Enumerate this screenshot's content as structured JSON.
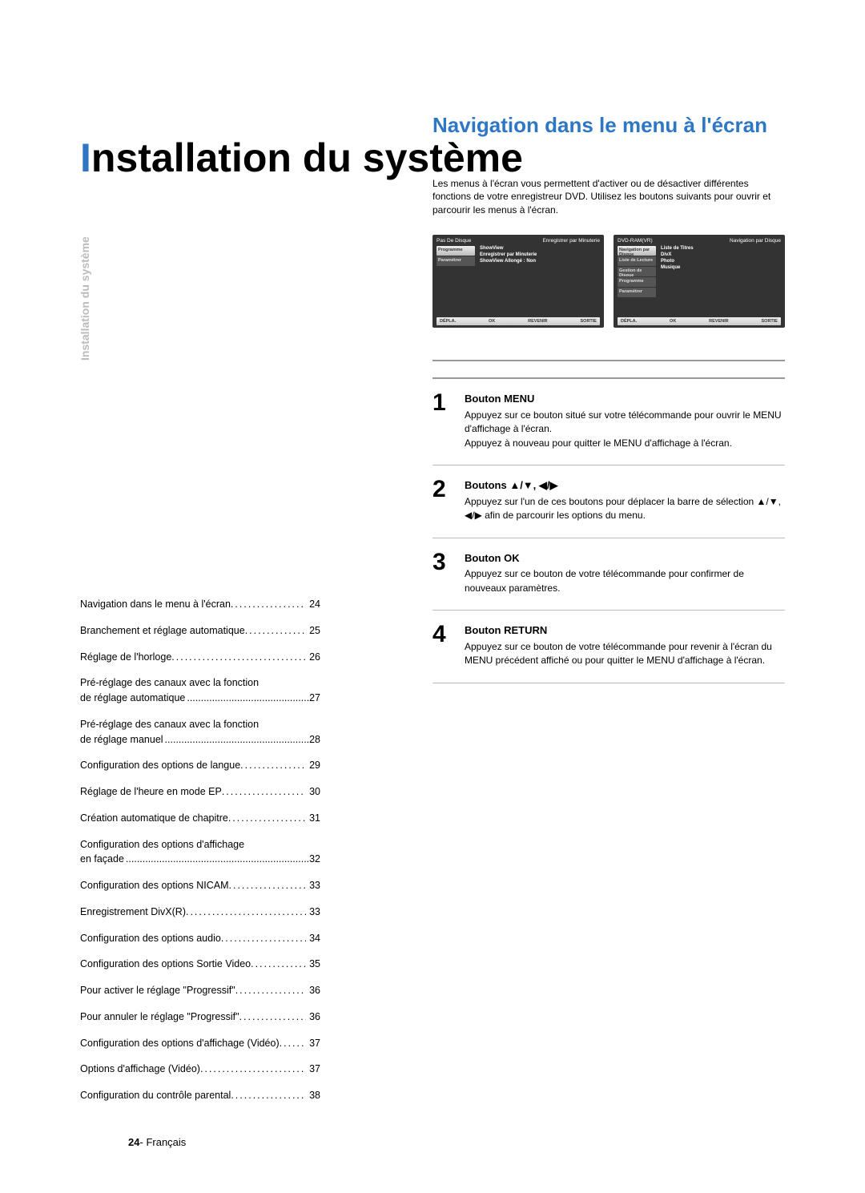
{
  "sidebar_tab": "Installation du système",
  "main_title_prefix": "I",
  "main_title_rest": "nstallation du système",
  "toc": [
    {
      "text": "Navigation dans le menu à l'écran",
      "page": "24"
    },
    {
      "text": "Branchement et réglage automatique",
      "page": "25"
    },
    {
      "text": "Réglage de l'horloge",
      "page": "26"
    },
    {
      "text": "Pré-réglage des canaux avec la fonction de réglage automatique",
      "page": "27",
      "multiline": true
    },
    {
      "text": "Pré-réglage des canaux avec la fonction de réglage manuel",
      "page": "28",
      "multiline": true
    },
    {
      "text": "Configuration des options de langue",
      "page": "29"
    },
    {
      "text": "Réglage de l'heure en mode EP",
      "page": "30"
    },
    {
      "text": "Création automatique de chapitre",
      "page": "31"
    },
    {
      "text": "Configuration des options d'affichage en façade",
      "page": "32",
      "multiline": true
    },
    {
      "text": "Configuration des options NICAM",
      "page": "33"
    },
    {
      "text": "Enregistrement DivX(R)",
      "page": "33"
    },
    {
      "text": "Configuration des options audio",
      "page": "34"
    },
    {
      "text": "Configuration des options Sortie Video",
      "page": "35"
    },
    {
      "text": "Pour activer le réglage \"Progressif\"",
      "page": "36"
    },
    {
      "text": "Pour annuler le réglage \"Progressif\"",
      "page": "36"
    },
    {
      "text": "Configuration des options d'affichage (Vidéo)",
      "page": "37"
    },
    {
      "text": "Options d'affichage (Vidéo)",
      "page": "37"
    },
    {
      "text": "Configuration du contrôle parental",
      "page": "38"
    }
  ],
  "section_heading": "Navigation dans le menu à l'écran",
  "intro_text": "Les menus à l'écran vous permettent d'activer ou de désactiver différentes fonctions de votre enregistreur DVD. Utilisez les boutons suivants pour ouvrir et parcourir les menus à l'écran.",
  "screens": {
    "left": {
      "header_left": "Pas De Disque",
      "header_right": "Enregistrer par Minuterie",
      "tabs": [
        "Programme",
        "Paramétrer"
      ],
      "list": [
        "ShowView",
        "Enregistrer par Minuterie",
        "ShowView Allongé : Non"
      ],
      "footer": [
        "DÉPLA.",
        "OK",
        "REVENIR",
        "SORTIE"
      ]
    },
    "right": {
      "header_left": "DVD-RAM(VR)",
      "header_right": "Navigation par Disque",
      "tabs": [
        "Navigation par Disque",
        "Liste de Lecture",
        "Gestion de Disque",
        "Programme",
        "Paramétrer"
      ],
      "list": [
        "Liste de Titres",
        "DivX",
        "Photo",
        "Musique"
      ],
      "footer": [
        "DÉPLA.",
        "OK",
        "REVENIR",
        "SORTIE"
      ]
    }
  },
  "steps": [
    {
      "num": "1",
      "title": "Bouton MENU",
      "body": "Appuyez sur ce bouton situé sur votre télécommande pour ouvrir le MENU d'affichage à l'écran.\nAppuyez à nouveau pour quitter le MENU d'affichage à l'écran."
    },
    {
      "num": "2",
      "title": "Boutons ▲/▼, ◀/▶",
      "body": "Appuyez sur l'un de ces boutons pour déplacer la barre de sélection ▲/▼, ◀/▶ afin de parcourir les options du menu."
    },
    {
      "num": "3",
      "title": "Bouton OK",
      "body": "Appuyez sur ce bouton de votre télécommande pour confirmer de nouveaux paramètres."
    },
    {
      "num": "4",
      "title": "Bouton RETURN",
      "body": "Appuyez sur ce bouton de votre télécommande pour revenir à l'écran du MENU précédent affiché ou pour quitter le MENU d'affichage à l'écran."
    }
  ],
  "footer": {
    "num": "24",
    "sep": "-",
    "lang": "Français"
  }
}
